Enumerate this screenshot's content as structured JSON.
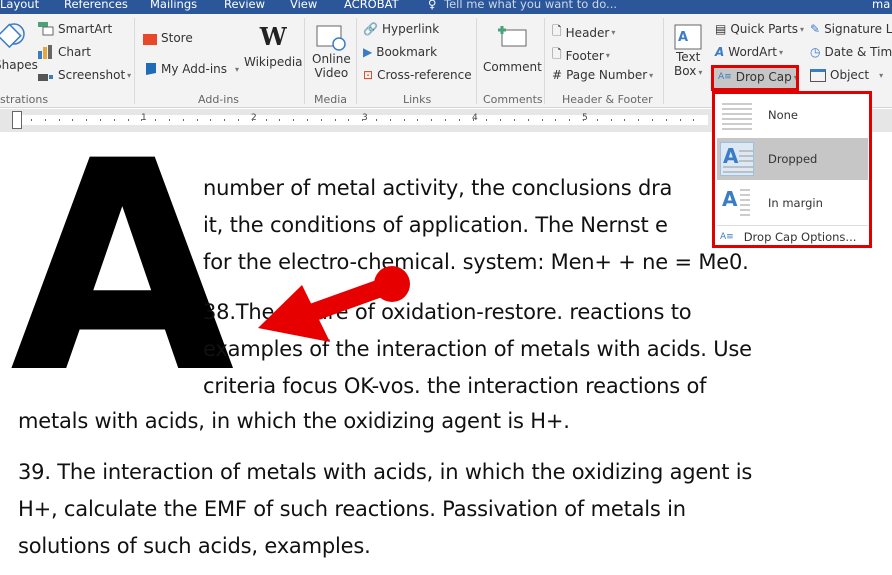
{
  "tabs": [
    "Layout",
    "References",
    "Mailings",
    "Review",
    "View",
    "ACROBAT"
  ],
  "tell_me": "Tell me what you want to do...",
  "user_fragment": "ma",
  "ribbon": {
    "illustrations": {
      "shapes": "Shapes",
      "smartart": "SmartArt",
      "chart": "Chart",
      "screenshot": "Screenshot",
      "group": "strations"
    },
    "addins": {
      "store": "Store",
      "my_addins": "My Add-ins",
      "wikipedia": "Wikipedia",
      "group": "Add-ins"
    },
    "media": {
      "online_video_1": "Online",
      "online_video_2": "Video",
      "group": "Media"
    },
    "links": {
      "hyperlink": "Hyperlink",
      "bookmark": "Bookmark",
      "crossref": "Cross-reference",
      "group": "Links"
    },
    "comments": {
      "comment": "Comment",
      "group": "Comments"
    },
    "header_footer": {
      "header": "Header",
      "footer": "Footer",
      "page_number": "Page Number",
      "group": "Header & Footer"
    },
    "text": {
      "text_box_1": "Text",
      "text_box_2": "Box",
      "quick_parts": "Quick Parts",
      "wordart": "WordArt",
      "drop_cap": "Drop Cap",
      "signature": "Signature Li",
      "datetime": "Date & Time",
      "object": "Object"
    }
  },
  "ruler": {
    "numbers": [
      "1",
      "2",
      "3",
      "4",
      "5"
    ]
  },
  "dropcap_menu": {
    "items": [
      {
        "label": "None"
      },
      {
        "label": "Dropped",
        "selected": true
      },
      {
        "label": "In margin"
      }
    ],
    "options": "Drop Cap Options..."
  },
  "document": {
    "dropcap_letter": "A",
    "lines": [
      " number of metal activity, the conclusions dra",
      "it, the conditions of application. The Nernst e",
      "for the electro-chemical. system: Men+ + ne = Me0.",
      "38.The nature of oxidation-restore. reactions to",
      "examples of the interaction of metals with acids. Use",
      "criteria focus OK-vos. the interaction reactions of",
      "metals with acids, in which the oxidizing agent is H+.",
      "39. The interaction of metals with acids, in which the oxidizing agent is",
      "H+, calculate the EMF of such reactions. Passivation of metals in",
      "solutions of such acids, examples."
    ]
  },
  "annotation_color": "#e60000"
}
